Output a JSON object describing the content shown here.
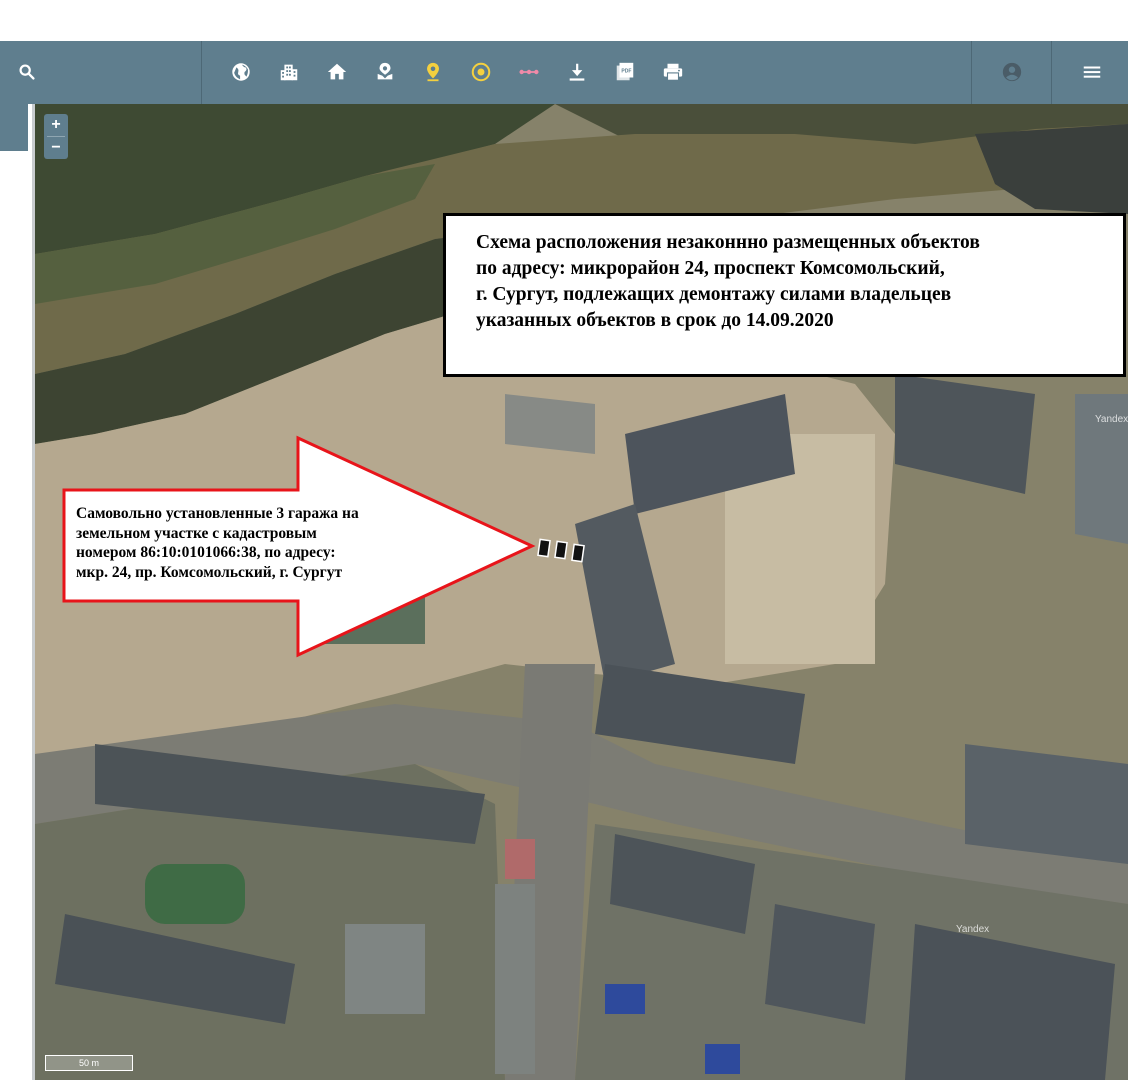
{
  "toolbar": {
    "search_icon": "search-icon",
    "tools": [
      "globe-icon",
      "buildings-icon",
      "home-icon",
      "parcel-icon",
      "pin-icon",
      "target-icon",
      "measure-line-icon",
      "download-icon",
      "pdf-icon",
      "print-icon"
    ],
    "account_icon": "account-icon",
    "menu_icon": "menu-icon",
    "pdf_badge": "PDF"
  },
  "map_controls": {
    "zoom_in": "+",
    "zoom_out": "−"
  },
  "title_box": {
    "lines": [
      "Схема расположения незаконнно размещенных объектов",
      "по адресу: микрорайон 24, проспект Комсомольский,",
      "г. Сургут, подлежащих демонтажу силами владельцев",
      "указанных объектов в срок до 14.09.2020"
    ]
  },
  "callout": {
    "lines": [
      "Самовольно установленные 3 гаража на",
      "земельном участке с кадастровым",
      "номером 86:10:0101066:38, по адресу:",
      "мкр. 24, пр. Комсомольский, г. Сургут"
    ]
  },
  "scale": {
    "label": "50 m"
  },
  "watermarks": [
    "Yandex",
    "Yandex"
  ],
  "colors": {
    "toolbar": "#5f7e8e",
    "arrow_border": "#e8141a",
    "pin_icon": "#f4d03f",
    "target_icon": "#f4d03f",
    "measure_icon": "#f08aa8"
  }
}
